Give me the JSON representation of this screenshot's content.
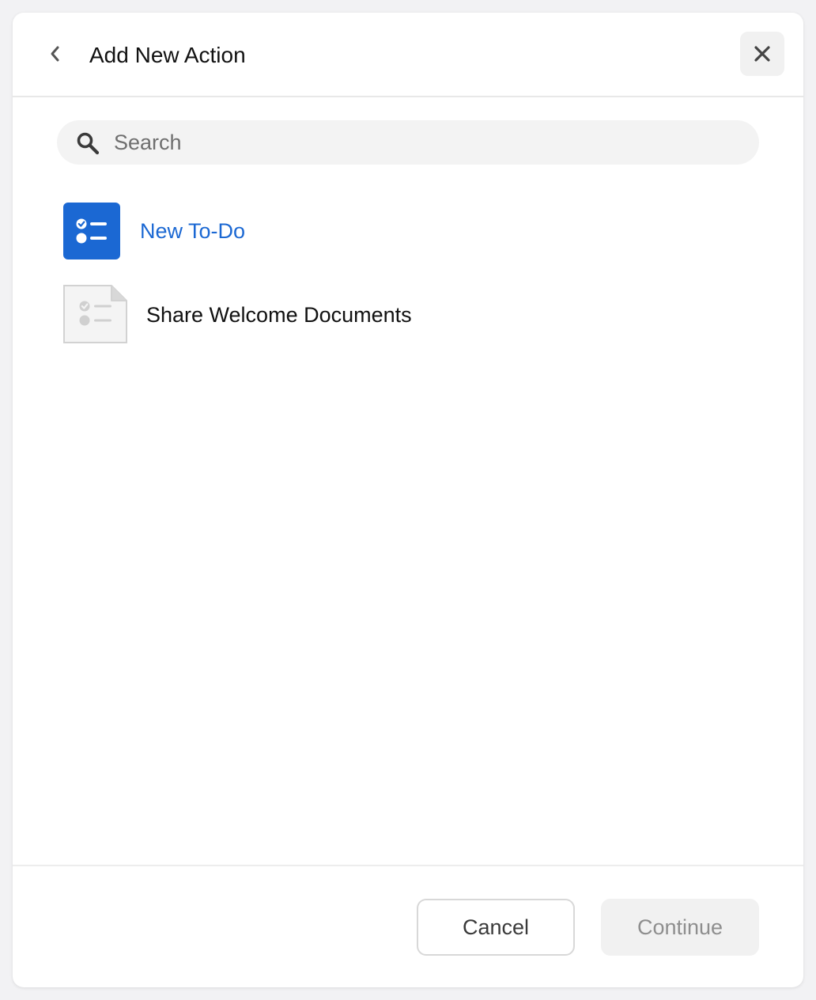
{
  "header": {
    "title": "Add New Action",
    "back_icon": "chevron-left-icon",
    "close_icon": "close-icon"
  },
  "search": {
    "placeholder": "Search",
    "value": "",
    "icon": "search-icon"
  },
  "actions": [
    {
      "label": "New To-Do",
      "icon": "todo-list-icon",
      "selected": true
    },
    {
      "label": "Share Welcome Documents",
      "icon": "document-checklist-icon",
      "selected": false
    }
  ],
  "footer": {
    "cancel_label": "Cancel",
    "continue_label": "Continue",
    "continue_disabled": true
  },
  "colors": {
    "accent": "#1b68d3",
    "disabled_text": "#8e8e8e"
  }
}
